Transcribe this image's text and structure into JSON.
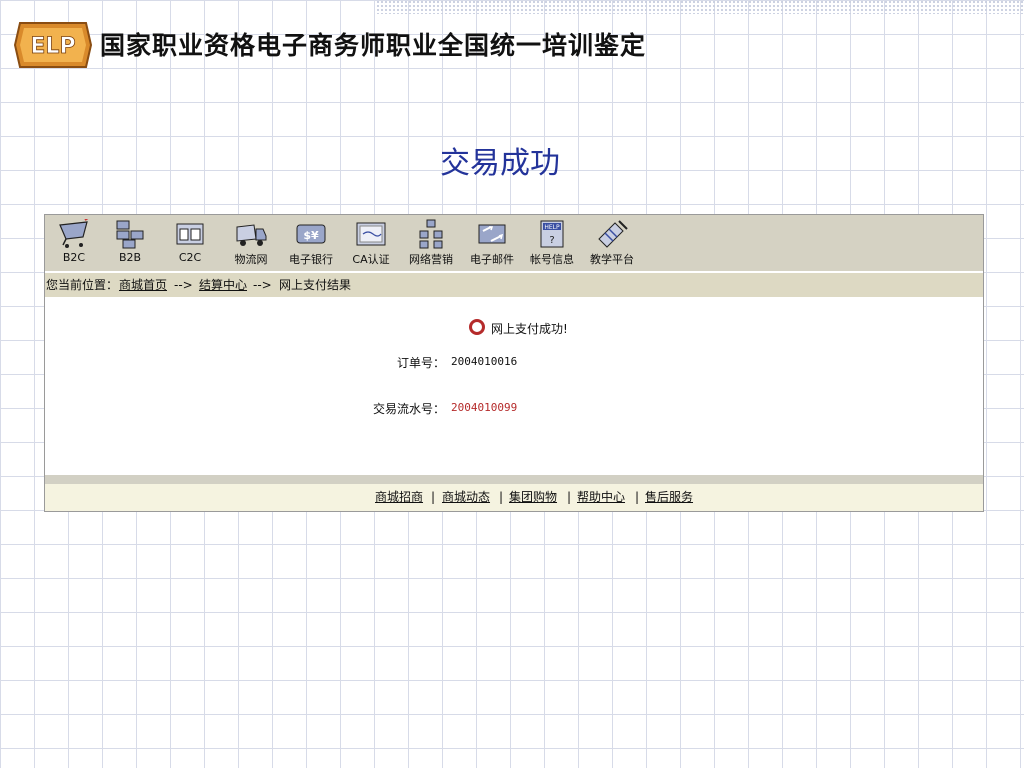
{
  "slide": {
    "title": "国家职业资格电子商务师职业全国统一培训鉴定",
    "logo_text": "ELP",
    "headline": "交易成功"
  },
  "toolbar": {
    "items": [
      {
        "label": "B2C",
        "icon": "shopping-cart-icon"
      },
      {
        "label": "B2B",
        "icon": "network-blocks-icon"
      },
      {
        "label": "C2C",
        "icon": "folders-icon"
      },
      {
        "label": "物流网",
        "icon": "truck-icon"
      },
      {
        "label": "电子银行",
        "icon": "money-card-icon"
      },
      {
        "label": "CA认证",
        "icon": "certificate-icon"
      },
      {
        "label": "网络营销",
        "icon": "org-chart-icon"
      },
      {
        "label": "电子邮件",
        "icon": "mail-exchange-icon"
      },
      {
        "label": "帐号信息",
        "icon": "help-document-icon"
      },
      {
        "label": "教学平台",
        "icon": "teaching-tools-icon"
      }
    ]
  },
  "breadcrumb": {
    "prefix": "您当前位置：",
    "home": "商城首页",
    "arrow1": "-->",
    "checkout": "结算中心",
    "arrow2": "-->",
    "current": "网上支付结果"
  },
  "result": {
    "message": "网上支付成功!",
    "order_label": "订单号：",
    "order_value": "2004010016",
    "trans_label": "交易流水号：",
    "trans_value": "2004010099"
  },
  "footer": {
    "links": [
      "商城招商",
      "商城动态",
      "集团购物",
      "帮助中心",
      "售后服务"
    ],
    "separator": "|"
  },
  "colors": {
    "headline": "#23339a",
    "toolbar_bg": "#d5d2c3",
    "trans_value": "#b52b2b",
    "success_dot": "#b52b2b"
  }
}
